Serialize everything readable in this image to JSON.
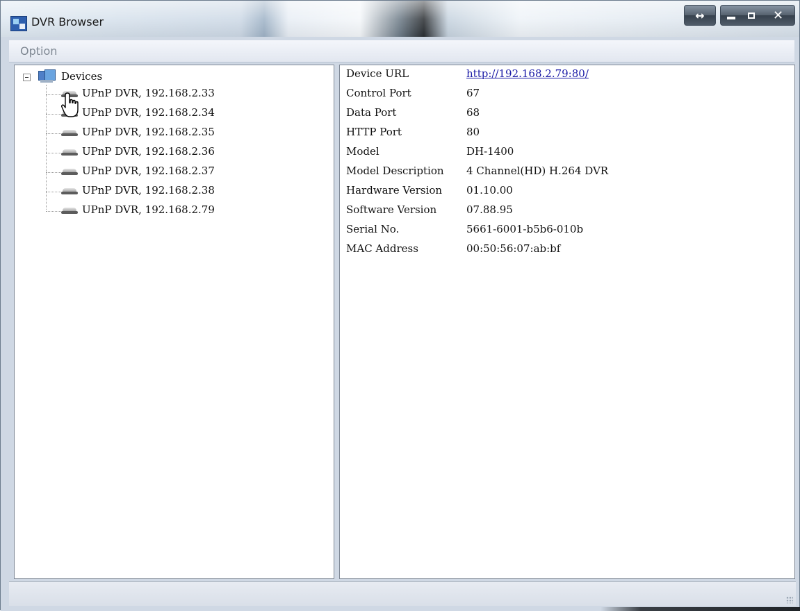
{
  "window": {
    "title": "DVR Browser"
  },
  "menu": {
    "items": [
      {
        "label": "Option"
      }
    ]
  },
  "tree": {
    "root_label": "Devices",
    "items": [
      {
        "label": "UPnP DVR, 192.168.2.33"
      },
      {
        "label": "UPnP DVR, 192.168.2.34"
      },
      {
        "label": "UPnP DVR, 192.168.2.35"
      },
      {
        "label": "UPnP DVR, 192.168.2.36"
      },
      {
        "label": "UPnP DVR, 192.168.2.37"
      },
      {
        "label": "UPnP DVR, 192.168.2.38"
      },
      {
        "label": "UPnP DVR, 192.168.2.79"
      }
    ]
  },
  "properties": [
    {
      "key": "Device URL",
      "value": "http://192.168.2.79:80/",
      "is_link": true
    },
    {
      "key": "Control Port",
      "value": "67"
    },
    {
      "key": "Data Port",
      "value": "68"
    },
    {
      "key": "HTTP Port",
      "value": "80"
    },
    {
      "key": "Model",
      "value": "DH-1400"
    },
    {
      "key": "Model Description",
      "value": "4 Channel(HD) H.264 DVR"
    },
    {
      "key": "Hardware Version",
      "value": "01.10.00"
    },
    {
      "key": "Software Version",
      "value": "07.88.95"
    },
    {
      "key": "Serial No.",
      "value": "5661-6001-b5b6-010b"
    },
    {
      "key": "MAC Address",
      "value": "00:50:56:07:ab:bf"
    }
  ],
  "icons": {
    "app": "dvr-browser-app-icon",
    "resize": "resize-arrows-icon",
    "minimize": "minimize-icon",
    "maximize": "maximize-icon",
    "close": "close-icon",
    "root": "network-computers-icon",
    "device": "dvr-device-icon",
    "cursor": "hand-pointer-icon"
  },
  "colors": {
    "link": "#1a1aa6",
    "menu_text": "#7e8792"
  }
}
